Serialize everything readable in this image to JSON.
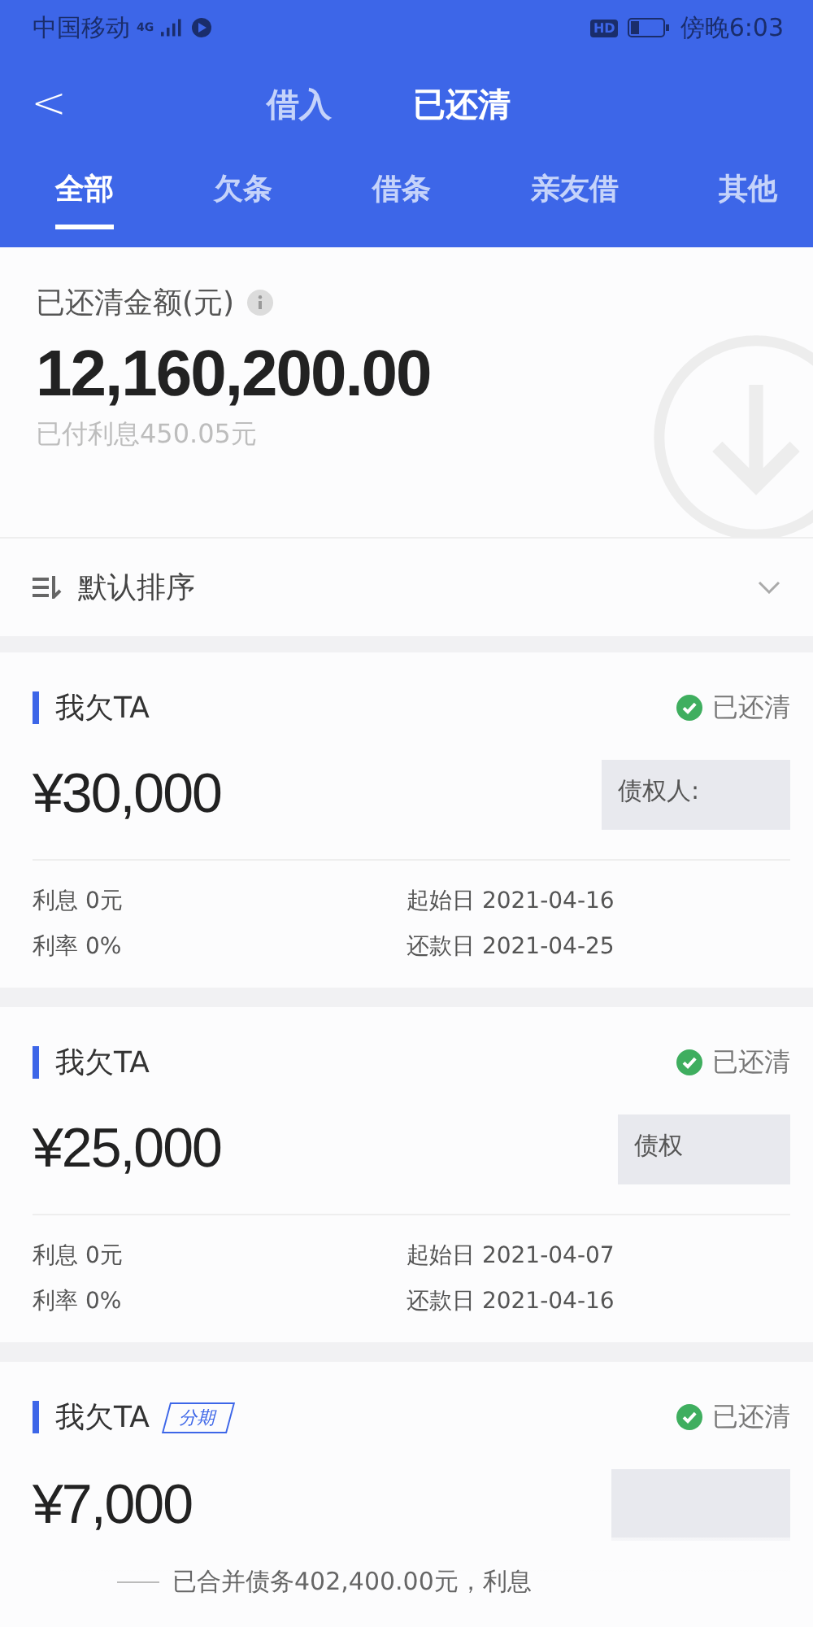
{
  "status_bar": {
    "carrier": "中国移动",
    "network": "4G",
    "time": "傍晚6:03",
    "hd": "HD"
  },
  "header": {
    "back": "<",
    "tabs": [
      {
        "label": "借入",
        "selected": false
      },
      {
        "label": "已还清",
        "selected": true
      }
    ]
  },
  "filter_tabs": [
    {
      "label": "全部",
      "selected": true
    },
    {
      "label": "欠条",
      "selected": false
    },
    {
      "label": "借条",
      "selected": false
    },
    {
      "label": "亲友借",
      "selected": false
    },
    {
      "label": "其他",
      "selected": false
    }
  ],
  "summary": {
    "label": "已还清金额(元)",
    "amount": "12,160,200.00",
    "interest": "已付利息450.05元"
  },
  "sort": {
    "label": "默认排序"
  },
  "cards": [
    {
      "title": "我欠TA",
      "status": "已还清",
      "amount": "¥30,000",
      "creditor": "债权人:",
      "interest": "利息 0元",
      "rate": "利率 0%",
      "start": "起始日 2021-04-16",
      "due": "还款日 2021-04-25"
    },
    {
      "title": "我欠TA",
      "status": "已还清",
      "amount": "¥25,000",
      "creditor": "债权",
      "interest": "利息 0元",
      "rate": "利率 0%",
      "start": "起始日 2021-04-07",
      "due": "还款日 2021-04-16"
    },
    {
      "title": "我欠TA",
      "tag": "分期",
      "status": "已还清",
      "amount": "¥7,000"
    }
  ],
  "footer": {
    "text": "已合并债务402,400.00元，利息"
  }
}
